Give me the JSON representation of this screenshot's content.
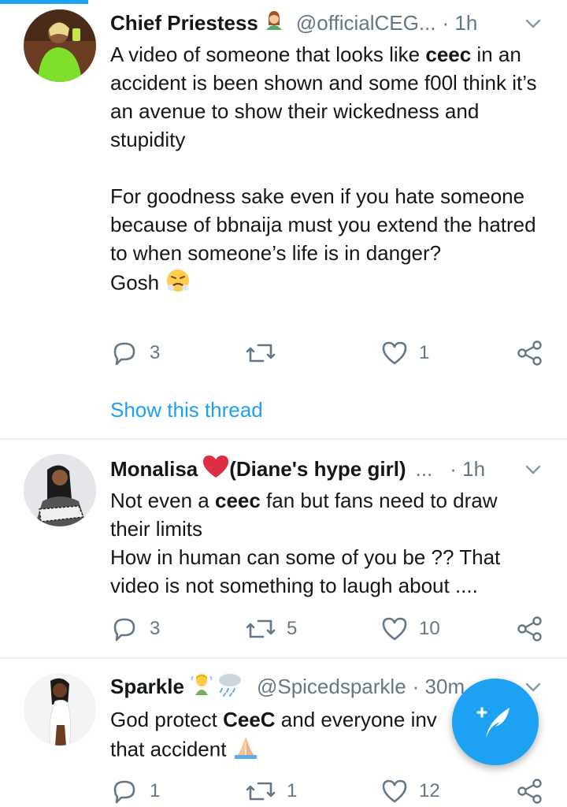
{
  "tweets": [
    {
      "name": "Chief Priestess",
      "name_emoji": "woman-in-green-emoji",
      "handle": "@officialCEG...",
      "time": "· 1h",
      "text_before_1": "A video of someone that looks like ",
      "bold_1": "ceec",
      "text_after_1": " in an accident is been shown and some f00l think it’s an avenue to show their wickedness and stupidity",
      "paragraph_2": "For goodness sake even if you hate someone because of bbnaija must you extend the hatred to when someone’s life is in danger?",
      "paragraph_3": "Gosh",
      "trail_emoji": "steam-face-emoji",
      "replies": "3",
      "retweets": "",
      "likes": "1",
      "show_thread": "Show this thread"
    },
    {
      "name": "Monalisa",
      "name_emoji": "red-heart-emoji",
      "name_suffix": "(Diane's hype girl)",
      "handle": "...",
      "time": "· 1h",
      "text_before_1": "Not even a ",
      "bold_1": "ceec",
      "text_after_1": " fan but fans need to draw their limits",
      "paragraph_2": "How in human can some of you be ?? That video is not something to laugh about ....",
      "replies": "3",
      "retweets": "5",
      "likes": "10"
    },
    {
      "name": "Sparkle",
      "name_emoji": "fairy-and-rain-cloud-emoji",
      "handle": "@Spicedsparkle",
      "time": "· 30m",
      "text_before_1": "God protect ",
      "bold_1": "CeeC",
      "text_after_1": " and everyone inv",
      "text_line_2": "that accident",
      "trail_emoji": "praying-hands-emoji",
      "replies": "1",
      "retweets": "1",
      "likes": "12"
    }
  ],
  "colors": {
    "accent": "#1da1f2",
    "text": "#14171a",
    "muted": "#657786",
    "divider": "#e6ecf0",
    "heart": "#e0245e"
  },
  "fab": {
    "icon": "compose-feather-icon"
  }
}
